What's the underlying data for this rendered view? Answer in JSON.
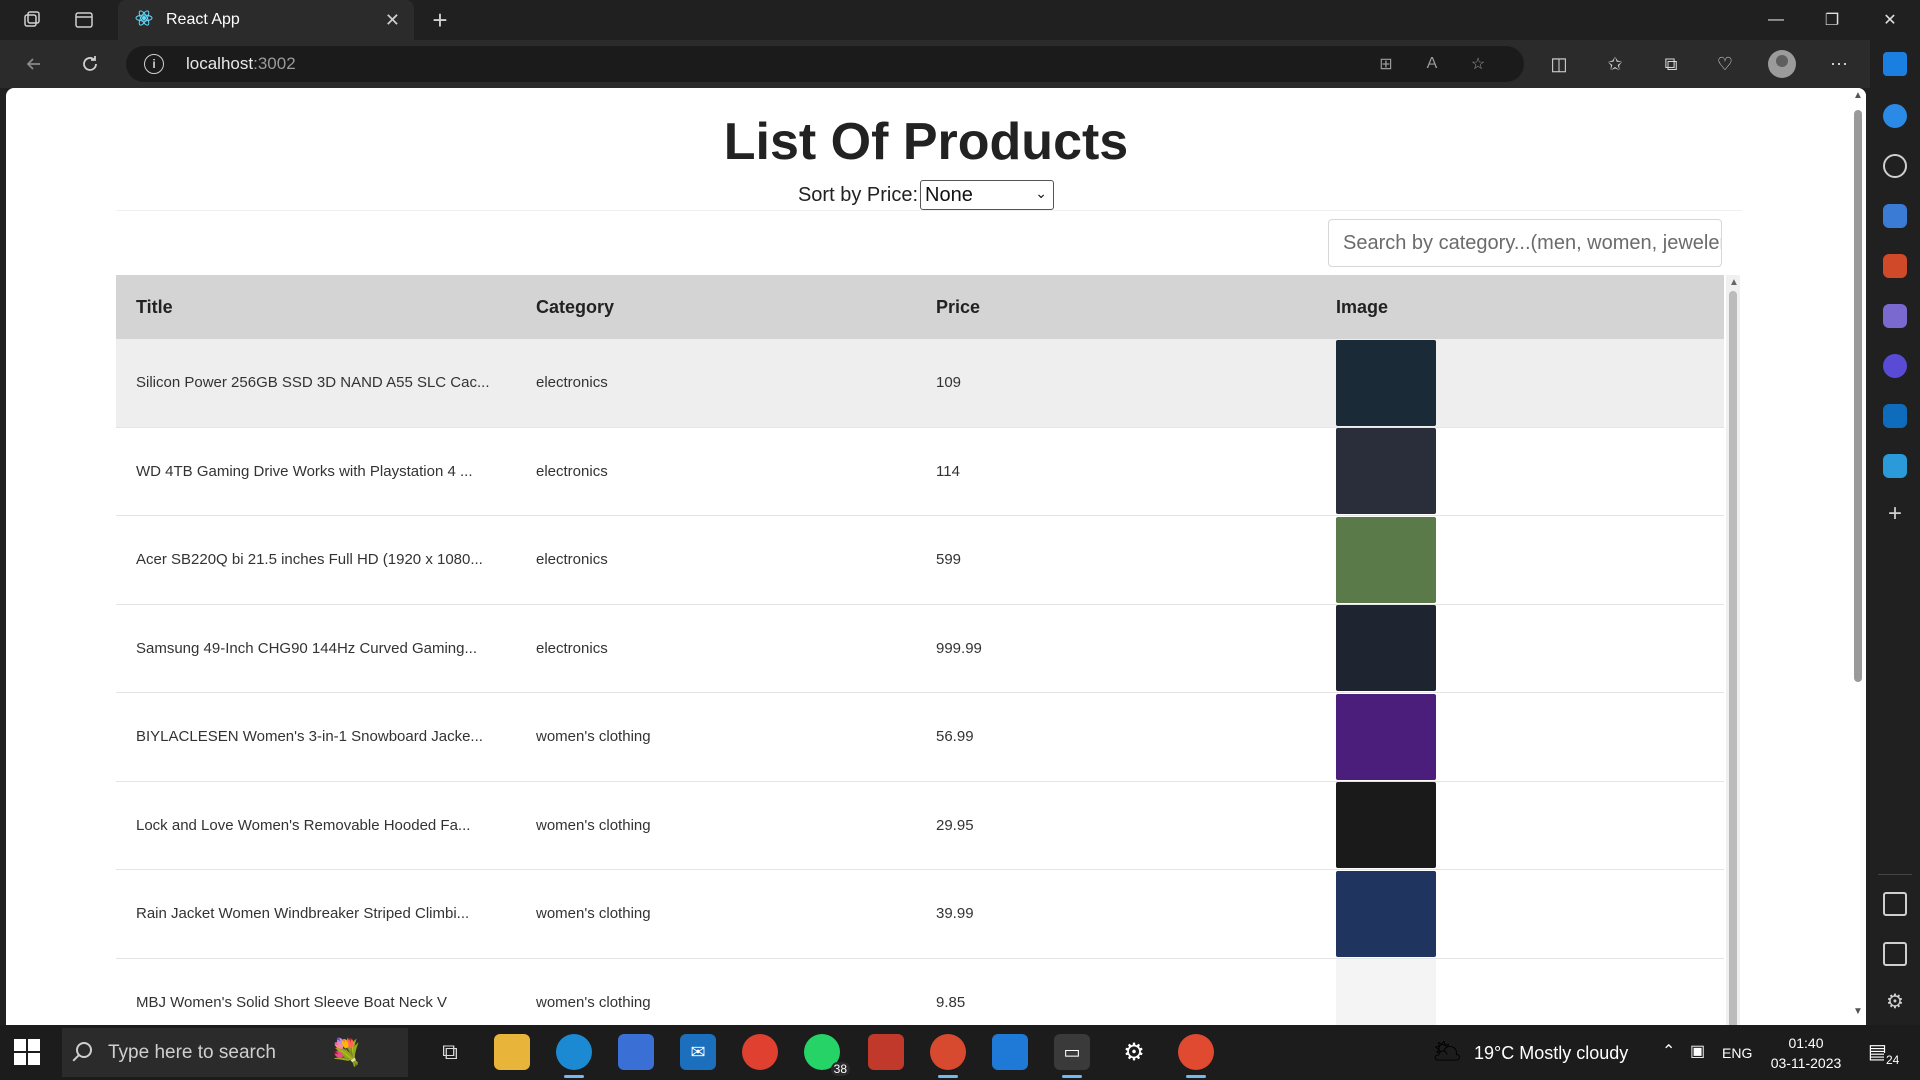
{
  "browser": {
    "tab_title": "React App",
    "url_host": "localhost",
    "url_port": ":3002"
  },
  "page": {
    "title": "List Of Products",
    "sort_label": "Sort by Price:",
    "sort_value": "None",
    "search_placeholder": "Search by category...(men, women, jewelery, electronics)",
    "columns": [
      "Title",
      "Category",
      "Price",
      "Image"
    ],
    "products": [
      {
        "title": "Silicon Power 256GB SSD 3D NAND A55 SLC Cac...",
        "category": "electronics",
        "price": "109",
        "image_color": "#1a2a36"
      },
      {
        "title": "WD 4TB Gaming Drive Works with Playstation 4 ...",
        "category": "electronics",
        "price": "114",
        "image_color": "#2a2d3a"
      },
      {
        "title": "Acer SB220Q bi 21.5 inches Full HD (1920 x 1080...",
        "category": "electronics",
        "price": "599",
        "image_color": "#5a7a4a"
      },
      {
        "title": "Samsung 49-Inch CHG90 144Hz Curved Gaming...",
        "category": "electronics",
        "price": "999.99",
        "image_color": "#1e2530"
      },
      {
        "title": "BIYLACLESEN Women's 3-in-1 Snowboard Jacke...",
        "category": "women's clothing",
        "price": "56.99",
        "image_color": "#4a1e7a"
      },
      {
        "title": "Lock and Love Women's Removable Hooded Fa...",
        "category": "women's clothing",
        "price": "29.95",
        "image_color": "#1a1a1a"
      },
      {
        "title": "Rain Jacket Women Windbreaker Striped Climbi...",
        "category": "women's clothing",
        "price": "39.99",
        "image_color": "#1f3560"
      },
      {
        "title": "MBJ Women's Solid Short Sleeve Boat Neck V",
        "category": "women's clothing",
        "price": "9.85",
        "image_color": "#f4f4f4"
      }
    ]
  },
  "taskbar": {
    "search_placeholder": "Type here to search",
    "whatsapp_badge": "38",
    "weather": "19°C  Mostly cloudy",
    "language": "ENG",
    "time": "01:40",
    "date": "03-11-2023",
    "notifications": "24"
  }
}
